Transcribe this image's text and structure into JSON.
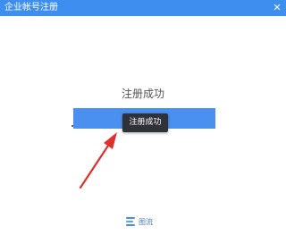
{
  "window": {
    "title": "企业帐号注册",
    "close_symbol": "✕"
  },
  "main": {
    "heading": "注册成功",
    "button_label": "",
    "tooltip_text": "注册成功"
  },
  "footer": {
    "logo_text": "图流",
    "logo_icon": "stack-logo-icon"
  },
  "annotation": {
    "arrow_color": "#e0302b",
    "arrow_icon": "red-arrow-icon"
  },
  "colors": {
    "titlebar": "#3e8ef0",
    "button": "#4a90f0",
    "tooltip_bg": "#2f3238",
    "heading_text": "#555555",
    "logo_text": "#4a78b8"
  }
}
